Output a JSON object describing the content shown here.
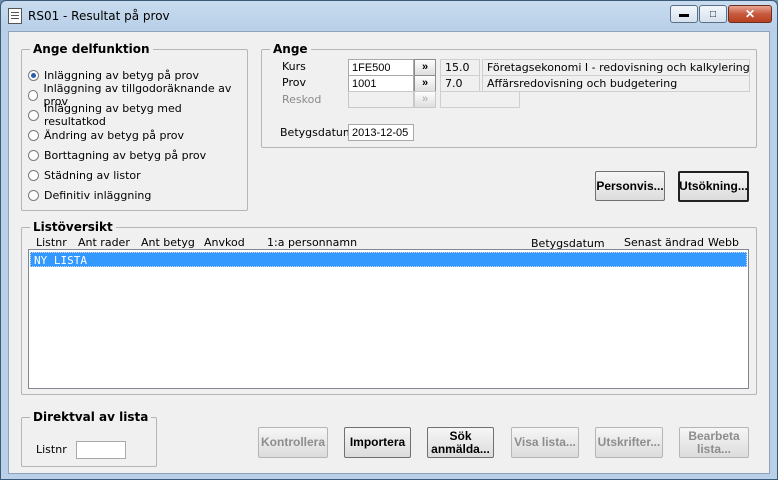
{
  "window": {
    "title": "RS01 - Resultat på prov",
    "minimize_label": "▬",
    "maximize_label": "□",
    "close_label": "✕"
  },
  "delfunktion": {
    "legend": "Ange delfunktion",
    "options": [
      {
        "label": "Inläggning av betyg på prov",
        "checked": true
      },
      {
        "label": "Inläggning av tillgodoräknande av prov",
        "checked": false
      },
      {
        "label": "Inläggning av betyg med resultatkod",
        "checked": false
      },
      {
        "label": "Ändring av betyg på prov",
        "checked": false
      },
      {
        "label": "Borttagning av betyg på prov",
        "checked": false
      },
      {
        "label": "Städning av listor",
        "checked": false
      },
      {
        "label": "Definitiv inläggning",
        "checked": false
      }
    ]
  },
  "ange": {
    "legend": "Ange",
    "kurs_label": "Kurs",
    "kurs_value": "1FE500",
    "kurs_hp": "15.0",
    "kurs_name": "Företagsekonomi I - redovisning och kalkylering",
    "prov_label": "Prov",
    "prov_value": "1001",
    "prov_hp": "7.0",
    "prov_name": "Affärsredovisning och budgetering",
    "reskod_label": "Reskod",
    "reskod_value": "",
    "reskod_desc": "",
    "betygsdatum_label": "Betygsdatum",
    "betygsdatum_value": "2013-12-05",
    "picker_label": "»"
  },
  "buttons": {
    "personvis": "Personvis...",
    "utsokning": "Utsökning..."
  },
  "listoversikt": {
    "legend": "Listöversikt",
    "columns": [
      "Listnr",
      "Ant rader",
      "Ant betyg",
      "Anvkod",
      "1:a personnamn",
      "Betygsdatum",
      "Senast ändrad",
      "Webb"
    ],
    "rows": [
      "NY LISTA"
    ]
  },
  "direktval": {
    "legend": "Direktval av lista",
    "listnr_label": "Listnr",
    "listnr_value": ""
  },
  "bottom_buttons": {
    "kontrollera": "Kontrollera",
    "importera": "Importera",
    "sok_anmalda": "Sök anmälda...",
    "visa_lista": "Visa lista...",
    "utskrifter": "Utskrifter...",
    "bearbeta_lista": "Bearbeta lista..."
  }
}
